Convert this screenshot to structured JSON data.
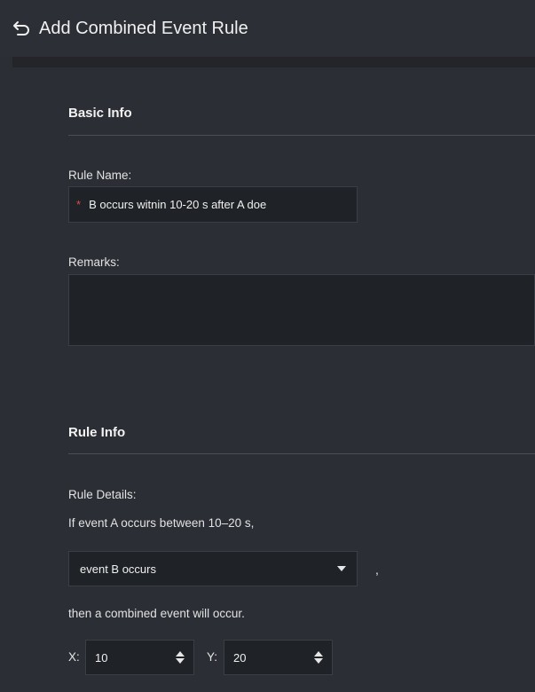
{
  "header": {
    "title": "Add Combined Event Rule",
    "back_icon": "back-arrow-icon"
  },
  "basic_info": {
    "heading": "Basic Info",
    "rule_name_label": "Rule Name:",
    "rule_name_required_mark": "*",
    "rule_name_value": "B occurs witnin 10-20 s after A doe",
    "remarks_label": "Remarks:",
    "remarks_value": ""
  },
  "rule_info": {
    "heading": "Rule Info",
    "details_label": "Rule Details:",
    "sentence_1": "If event A occurs between 10–20 s,",
    "event_select": {
      "selected": "event B occurs"
    },
    "comma": ",",
    "sentence_2": "then a combined event will occur.",
    "x": {
      "label": "X:",
      "value": "10"
    },
    "y": {
      "label": "Y:",
      "value": "20"
    }
  },
  "colors": {
    "background": "#2b2e34",
    "input_bg": "#1f2226",
    "required": "#e04a4a"
  }
}
